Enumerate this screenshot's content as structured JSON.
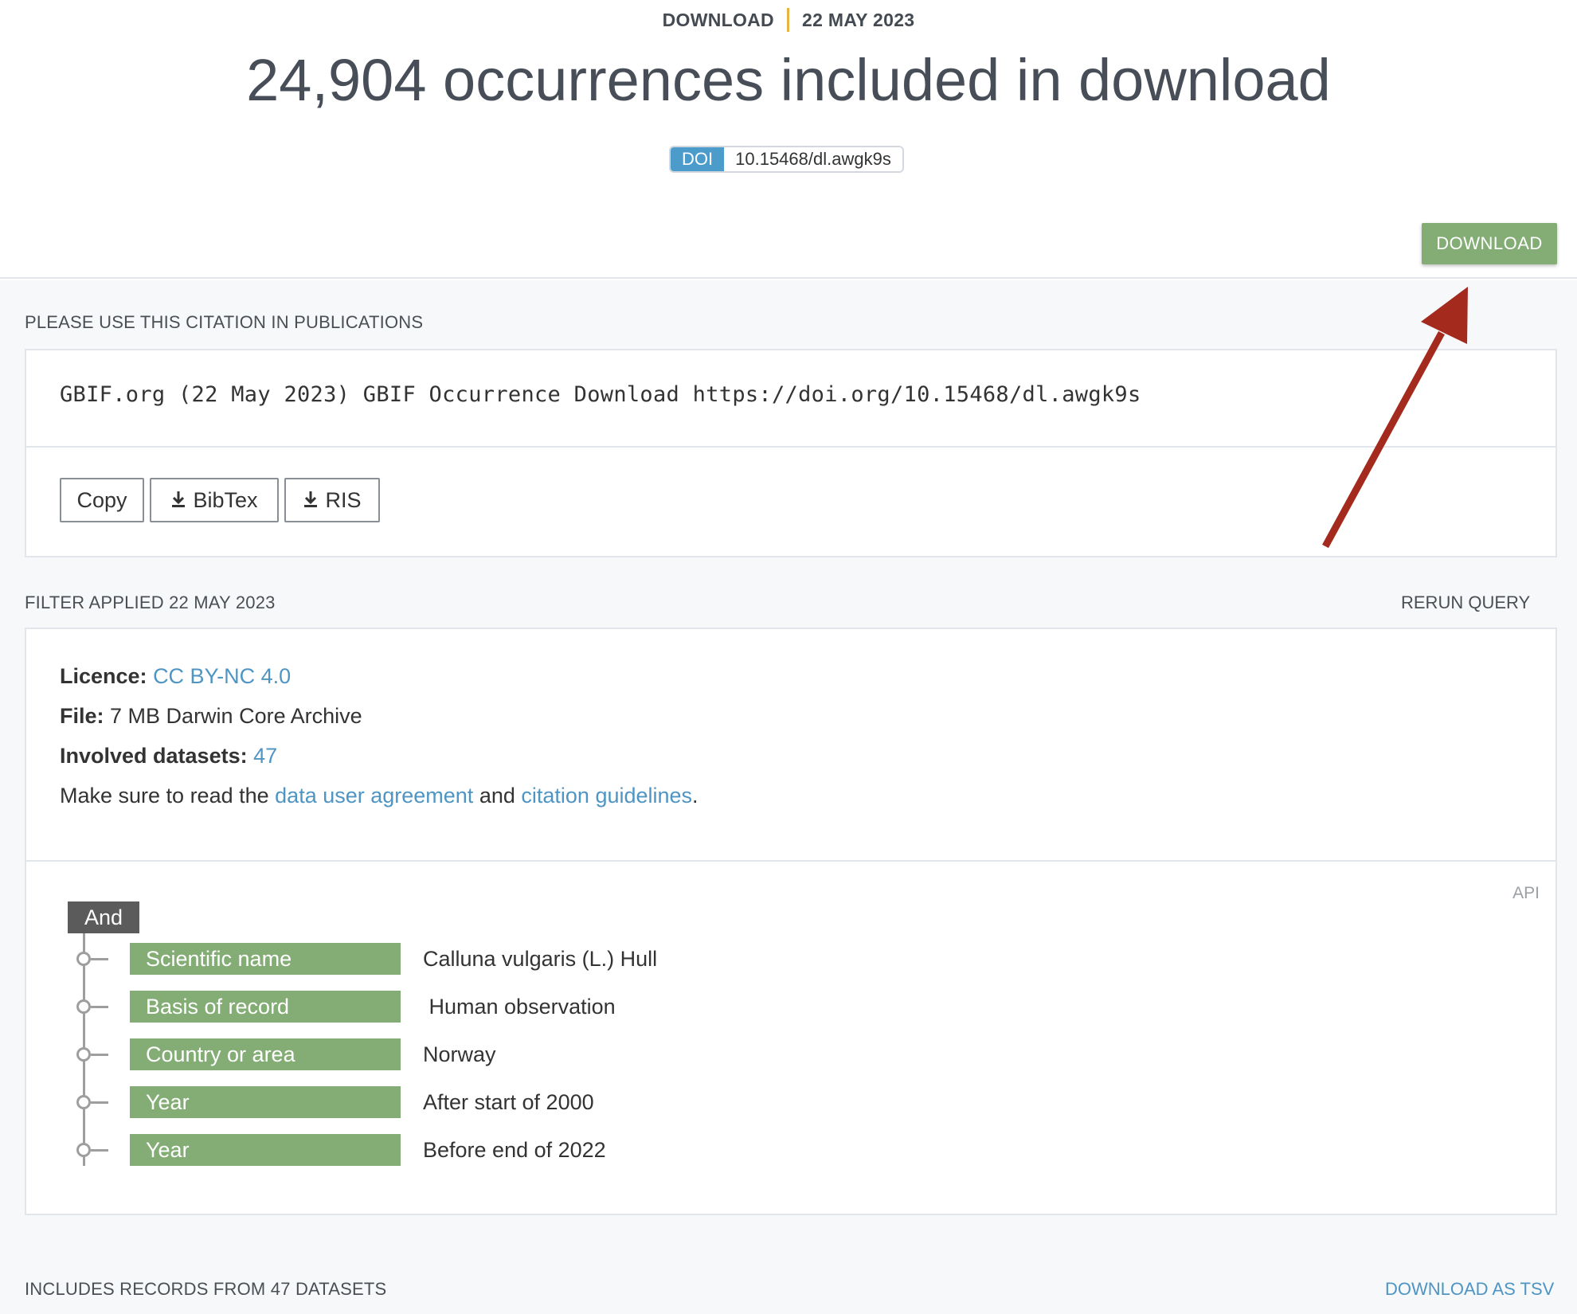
{
  "header": {
    "kicker_type": "DOWNLOAD",
    "kicker_date": "22 MAY 2023",
    "title": "24,904 occurrences included in download",
    "doi_label": "DOI",
    "doi_value": "10.15468/dl.awgk9s",
    "download_button": "DOWNLOAD"
  },
  "citation": {
    "section_label": "PLEASE USE THIS CITATION IN PUBLICATIONS",
    "text": "GBIF.org (22 May 2023) GBIF Occurrence Download https://doi.org/10.15468/dl.awgk9s",
    "buttons": {
      "copy": "Copy",
      "bibtex": "BibTex",
      "ris": "RIS"
    }
  },
  "filter": {
    "section_label": "FILTER APPLIED 22 MAY 2023",
    "rerun_label": "RERUN QUERY",
    "licence_label": "Licence:",
    "licence_value": "CC BY-NC 4.0",
    "file_label": "File:",
    "file_value": "7 MB Darwin Core Archive",
    "datasets_label": "Involved datasets:",
    "datasets_value": "47",
    "notice_prefix": "Make sure to read the ",
    "notice_link1": "data user agreement",
    "notice_middle": " and ",
    "notice_link2": "citation guidelines",
    "notice_suffix": ".",
    "api_label": "API",
    "operator": "And",
    "rows": [
      {
        "field": "Scientific name",
        "value": "Calluna vulgaris (L.) Hull"
      },
      {
        "field": "Basis of record",
        "value": " Human observation"
      },
      {
        "field": "Country or area",
        "value": "Norway"
      },
      {
        "field": "Year",
        "value": "After start of 2000"
      },
      {
        "field": "Year",
        "value": "Before end of 2022"
      }
    ]
  },
  "datasets": {
    "section_label": "INCLUDES RECORDS FROM 47 DATASETS",
    "download_tsv": "DOWNLOAD AS TSV"
  },
  "colors": {
    "accent_green": "#83ad75",
    "doi_blue": "#4b9bcb",
    "link_blue": "#4e95c4",
    "annotation_arrow": "#a52a1e"
  },
  "icons": [
    "download-icon",
    "annotation-arrow-icon"
  ]
}
